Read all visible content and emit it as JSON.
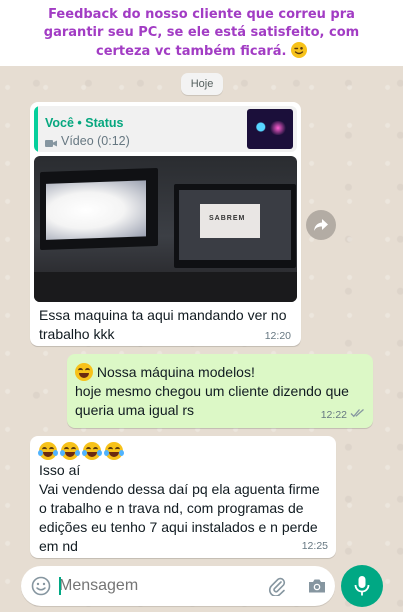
{
  "banner": {
    "text": "Feedback do nosso cliente que correu pra garantir seu PC, se ele está satisfeito, com certeza vc também ficará."
  },
  "chat": {
    "date_chip": "Hoje",
    "messages": [
      {
        "direction": "incoming",
        "quote_author": "Você • Status",
        "quote_subtitle": "Vídeo (0:12)",
        "video_screen_text": "SABREM",
        "text": "Essa maquina ta aqui mandando ver no trabalho kkk",
        "time": "12:20"
      },
      {
        "direction": "outgoing",
        "line1": "Nossa máquina modelos!",
        "line2": "hoje mesmo chegou um cliente dizendo que queria uma igual rs",
        "time": "12:22",
        "status": "read"
      },
      {
        "direction": "incoming",
        "emoji_count": 4,
        "line1": "Isso aí",
        "line2": "Vai vendendo dessa daí pq ela aguenta firme o trabalho e n trava nd, com programas de edições eu tenho 7 aqui instalados e n perde em nd",
        "time": "12:25"
      }
    ]
  },
  "composer": {
    "placeholder": "Mensagem"
  },
  "icons": {
    "emoji": "emoji-icon",
    "attach": "paperclip-icon",
    "camera": "camera-icon",
    "mic": "mic-icon",
    "forward": "forward-icon",
    "read_receipt": "double-check-icon"
  },
  "colors": {
    "banner_text": "#a23cc4",
    "accent": "#00a884",
    "outgoing_bubble": "#dcf8c6",
    "incoming_bubble": "#ffffff",
    "status_author": "#06a77f",
    "read_ticks": "#53bdeb"
  }
}
